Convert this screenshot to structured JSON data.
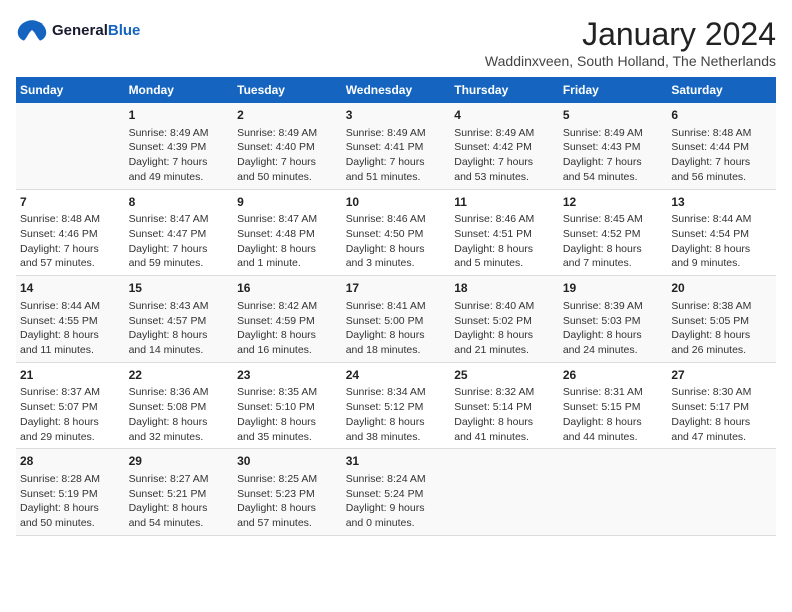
{
  "header": {
    "logo_line1": "General",
    "logo_line2": "Blue",
    "month_title": "January 2024",
    "location": "Waddinxveen, South Holland, The Netherlands"
  },
  "days_of_week": [
    "Sunday",
    "Monday",
    "Tuesday",
    "Wednesday",
    "Thursday",
    "Friday",
    "Saturday"
  ],
  "weeks": [
    [
      {
        "day": "",
        "info": ""
      },
      {
        "day": "1",
        "info": "Sunrise: 8:49 AM\nSunset: 4:39 PM\nDaylight: 7 hours\nand 49 minutes."
      },
      {
        "day": "2",
        "info": "Sunrise: 8:49 AM\nSunset: 4:40 PM\nDaylight: 7 hours\nand 50 minutes."
      },
      {
        "day": "3",
        "info": "Sunrise: 8:49 AM\nSunset: 4:41 PM\nDaylight: 7 hours\nand 51 minutes."
      },
      {
        "day": "4",
        "info": "Sunrise: 8:49 AM\nSunset: 4:42 PM\nDaylight: 7 hours\nand 53 minutes."
      },
      {
        "day": "5",
        "info": "Sunrise: 8:49 AM\nSunset: 4:43 PM\nDaylight: 7 hours\nand 54 minutes."
      },
      {
        "day": "6",
        "info": "Sunrise: 8:48 AM\nSunset: 4:44 PM\nDaylight: 7 hours\nand 56 minutes."
      }
    ],
    [
      {
        "day": "7",
        "info": "Sunrise: 8:48 AM\nSunset: 4:46 PM\nDaylight: 7 hours\nand 57 minutes."
      },
      {
        "day": "8",
        "info": "Sunrise: 8:47 AM\nSunset: 4:47 PM\nDaylight: 7 hours\nand 59 minutes."
      },
      {
        "day": "9",
        "info": "Sunrise: 8:47 AM\nSunset: 4:48 PM\nDaylight: 8 hours\nand 1 minute."
      },
      {
        "day": "10",
        "info": "Sunrise: 8:46 AM\nSunset: 4:50 PM\nDaylight: 8 hours\nand 3 minutes."
      },
      {
        "day": "11",
        "info": "Sunrise: 8:46 AM\nSunset: 4:51 PM\nDaylight: 8 hours\nand 5 minutes."
      },
      {
        "day": "12",
        "info": "Sunrise: 8:45 AM\nSunset: 4:52 PM\nDaylight: 8 hours\nand 7 minutes."
      },
      {
        "day": "13",
        "info": "Sunrise: 8:44 AM\nSunset: 4:54 PM\nDaylight: 8 hours\nand 9 minutes."
      }
    ],
    [
      {
        "day": "14",
        "info": "Sunrise: 8:44 AM\nSunset: 4:55 PM\nDaylight: 8 hours\nand 11 minutes."
      },
      {
        "day": "15",
        "info": "Sunrise: 8:43 AM\nSunset: 4:57 PM\nDaylight: 8 hours\nand 14 minutes."
      },
      {
        "day": "16",
        "info": "Sunrise: 8:42 AM\nSunset: 4:59 PM\nDaylight: 8 hours\nand 16 minutes."
      },
      {
        "day": "17",
        "info": "Sunrise: 8:41 AM\nSunset: 5:00 PM\nDaylight: 8 hours\nand 18 minutes."
      },
      {
        "day": "18",
        "info": "Sunrise: 8:40 AM\nSunset: 5:02 PM\nDaylight: 8 hours\nand 21 minutes."
      },
      {
        "day": "19",
        "info": "Sunrise: 8:39 AM\nSunset: 5:03 PM\nDaylight: 8 hours\nand 24 minutes."
      },
      {
        "day": "20",
        "info": "Sunrise: 8:38 AM\nSunset: 5:05 PM\nDaylight: 8 hours\nand 26 minutes."
      }
    ],
    [
      {
        "day": "21",
        "info": "Sunrise: 8:37 AM\nSunset: 5:07 PM\nDaylight: 8 hours\nand 29 minutes."
      },
      {
        "day": "22",
        "info": "Sunrise: 8:36 AM\nSunset: 5:08 PM\nDaylight: 8 hours\nand 32 minutes."
      },
      {
        "day": "23",
        "info": "Sunrise: 8:35 AM\nSunset: 5:10 PM\nDaylight: 8 hours\nand 35 minutes."
      },
      {
        "day": "24",
        "info": "Sunrise: 8:34 AM\nSunset: 5:12 PM\nDaylight: 8 hours\nand 38 minutes."
      },
      {
        "day": "25",
        "info": "Sunrise: 8:32 AM\nSunset: 5:14 PM\nDaylight: 8 hours\nand 41 minutes."
      },
      {
        "day": "26",
        "info": "Sunrise: 8:31 AM\nSunset: 5:15 PM\nDaylight: 8 hours\nand 44 minutes."
      },
      {
        "day": "27",
        "info": "Sunrise: 8:30 AM\nSunset: 5:17 PM\nDaylight: 8 hours\nand 47 minutes."
      }
    ],
    [
      {
        "day": "28",
        "info": "Sunrise: 8:28 AM\nSunset: 5:19 PM\nDaylight: 8 hours\nand 50 minutes."
      },
      {
        "day": "29",
        "info": "Sunrise: 8:27 AM\nSunset: 5:21 PM\nDaylight: 8 hours\nand 54 minutes."
      },
      {
        "day": "30",
        "info": "Sunrise: 8:25 AM\nSunset: 5:23 PM\nDaylight: 8 hours\nand 57 minutes."
      },
      {
        "day": "31",
        "info": "Sunrise: 8:24 AM\nSunset: 5:24 PM\nDaylight: 9 hours\nand 0 minutes."
      },
      {
        "day": "",
        "info": ""
      },
      {
        "day": "",
        "info": ""
      },
      {
        "day": "",
        "info": ""
      }
    ]
  ]
}
